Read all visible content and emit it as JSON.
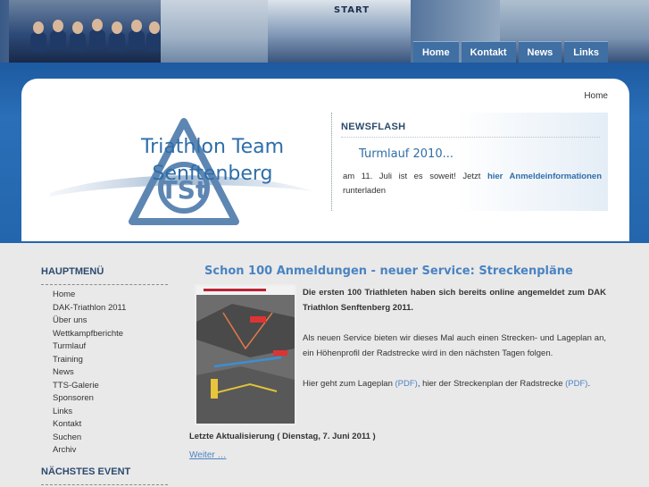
{
  "banner": {
    "start_tag": "START"
  },
  "topnav": {
    "items": [
      {
        "label": "Home"
      },
      {
        "label": "Kontakt"
      },
      {
        "label": "News"
      },
      {
        "label": "Links"
      }
    ]
  },
  "breadcrumb": "Home",
  "logo": {
    "title": "Triathlon Team Senftenberg",
    "emblem_text": "TSt"
  },
  "newsflash": {
    "heading": "NEWSFLASH",
    "title": "Turmlauf 2010...",
    "body_prefix": "am 11. Juli ist es soweit! Jetzt",
    "link_text": "hier Anmeldeinformationen",
    "body_suffix": "runterladen"
  },
  "sidebar": {
    "menu_heading": "HAUPTMENÜ",
    "items": [
      {
        "label": "Home"
      },
      {
        "label": "DAK-Triathlon 2011"
      },
      {
        "label": "Über uns"
      },
      {
        "label": "Wettkampfberichte"
      },
      {
        "label": "Turmlauf"
      },
      {
        "label": "Training"
      },
      {
        "label": "News"
      },
      {
        "label": "TTS-Galerie"
      },
      {
        "label": "Sponsoren"
      },
      {
        "label": "Links"
      },
      {
        "label": "Kontakt"
      },
      {
        "label": "Suchen"
      },
      {
        "label": "Archiv"
      }
    ],
    "event_heading": "NÄCHSTES EVENT"
  },
  "article": {
    "title": "Schon 100 Anmeldungen - neuer Service: Streckenpläne",
    "intro_bold": "Die ersten 100 Triathleten haben sich bereits online angemeldet zum DAK Triathlon Senftenberg 2011.",
    "paragraph2": "Als neuen Service bieten wir dieses Mal auch einen Strecken- und Lageplan an, ein Höhenprofil der Radstrecke wird in den nächsten Tagen folgen.",
    "p3_prefix": "Hier geht zum Lageplan",
    "p3_link1": "(PDF)",
    "p3_middle": ", hier der Streckenplan der Radstrecke",
    "p3_link2": "(PDF)",
    "p3_suffix": ".",
    "updated": "Letzte Aktualisierung ( Dienstag, 7. Juni 2011 )",
    "more": "Weiter …"
  },
  "colors": {
    "brand_blue": "#2e6ea8",
    "band_blue": "#2366ad",
    "nav_tab": "#3f6fa3",
    "link_blue": "#4a83c2"
  }
}
